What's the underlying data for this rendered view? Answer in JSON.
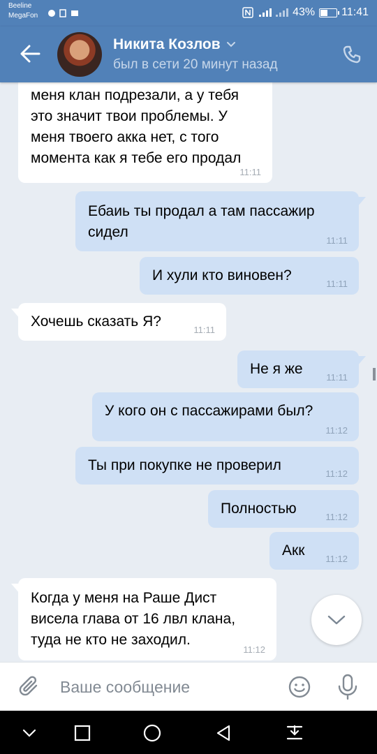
{
  "status_bar": {
    "carrier_1": "Beeline",
    "carrier_2": "MegaFon",
    "battery": "43%",
    "time": "11:41"
  },
  "header": {
    "contact_name": "Никита Козлов",
    "presence": "был в сети 20 минут назад",
    "back_icon": "arrow-left-icon",
    "call_icon": "phone-icon"
  },
  "messages": [
    {
      "dir": "in",
      "text_lines": [
        "меня клан подрезали, а у тебя",
        "это значит твои проблемы. У",
        "меня твоего акка нет, с того",
        "момента как я тебе его продал"
      ],
      "time": "11:11"
    },
    {
      "dir": "out",
      "text_lines": [
        "Ебаиь ты продал а там пассажир",
        "сидел"
      ],
      "time": "11:11"
    },
    {
      "dir": "out",
      "text_lines": [
        "И хули кто виновен?"
      ],
      "time": "11:11"
    },
    {
      "dir": "in",
      "text_lines": [
        "Хочешь сказать Я?"
      ],
      "time": "11:11"
    },
    {
      "dir": "out",
      "text_lines": [
        "Не я же"
      ],
      "time": "11:11"
    },
    {
      "dir": "out",
      "text_lines": [
        "У кого он с пассажирами был?"
      ],
      "time": "11:12"
    },
    {
      "dir": "out",
      "text_lines": [
        "Ты при покупке не проверил"
      ],
      "time": "11:12"
    },
    {
      "dir": "out",
      "text_lines": [
        "Полностью"
      ],
      "time": "11:12"
    },
    {
      "dir": "out",
      "text_lines": [
        "Акк"
      ],
      "time": "11:12"
    },
    {
      "dir": "in",
      "text_lines": [
        "Когда у меня на Раше Дист",
        "висела глава от 16 лвл клана,",
        "туда не кто не заходил."
      ],
      "time": "11:12"
    }
  ],
  "composer": {
    "placeholder": "Ваше сообщение"
  },
  "colors": {
    "header": "#5181b8",
    "incoming_bubble": "#ffffff",
    "outgoing_bubble": "#cfe0f5",
    "background": "#e8edf3"
  }
}
